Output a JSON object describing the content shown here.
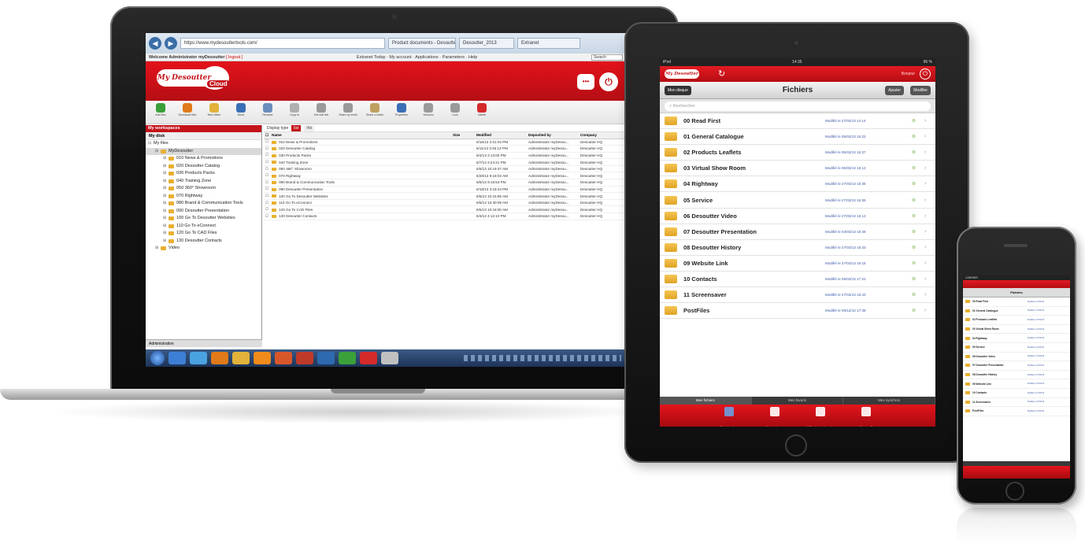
{
  "laptop": {
    "browser": {
      "address": "https://www.mydesouttertools.com/",
      "tabs": [
        "Product documents - Desoutter",
        "Desoutter_2013",
        "Extranet"
      ],
      "search_placeholder": "Search",
      "welcome": "Welcome Administrator myDesoutter",
      "logout": "[ logout ]",
      "menu_links": "Extranet Today · My account · Applications · Parameters · Help"
    },
    "app": {
      "logo_text": "My Desoutter",
      "logo_cloud": "Cloud",
      "toolbar": [
        {
          "label": "Add files",
          "icon": "add-icon",
          "color": "#3aa03a"
        },
        {
          "label": "Download files",
          "icon": "download-icon",
          "color": "#e07a1a"
        },
        {
          "label": "New folder",
          "icon": "new-folder-icon",
          "color": "#e2b23a"
        },
        {
          "label": "Move",
          "icon": "move-icon",
          "color": "#3a6fb5"
        },
        {
          "label": "Rename",
          "icon": "rename-icon",
          "color": "#6a8fbf"
        },
        {
          "label": "Copy to",
          "icon": "copy-icon",
          "color": "#b0b0b0"
        },
        {
          "label": "Get edit link",
          "icon": "edit-link-icon",
          "color": "#9a9a9a"
        },
        {
          "label": "Share by email",
          "icon": "share-email-icon",
          "color": "#9a9a9a"
        },
        {
          "label": "Share a folder",
          "icon": "share-folder-icon",
          "color": "#c0a060"
        },
        {
          "label": "Properties",
          "icon": "info-icon",
          "color": "#3a6fb5"
        },
        {
          "label": "Versions",
          "icon": "versions-icon",
          "color": "#9a9a9a"
        },
        {
          "label": "Lock",
          "icon": "lock-icon",
          "color": "#9a9a9a"
        },
        {
          "label": "Delete",
          "icon": "delete-icon",
          "color": "#d42a2a"
        }
      ],
      "hdr_btn1": "•••",
      "hdr_btn2": "⏻",
      "workspace_title": "My workspaces",
      "my_disk": "My disk",
      "my_files": "My files",
      "tree": [
        "MyDesoutter",
        "010 News & Promotions",
        "020 Desoutter Catalog",
        "030 Products Packs",
        "040 Training Zone",
        "050 360° Showroom",
        "070 Rightway",
        "080 Brand & Communication Tools",
        "090 Desoutter Presentation",
        "100 Go To Desoutter Websites",
        "110 Go To eConnect",
        "120 Go To CAD Files",
        "130 Desoutter Contacts",
        "Video"
      ],
      "administration": "Administration",
      "display_type": "Display type",
      "display_opt1": "list",
      "display_opt2": "thb",
      "columns": [
        "Name",
        "Size",
        "Modified",
        "Deposited by",
        "Company"
      ],
      "files": [
        [
          "010 News & Promotions",
          "",
          "6/18/13 2:01:04 PM",
          "Administrator myDesou...",
          "Desoutter HQ"
        ],
        [
          "020 Desoutter Catalog",
          "",
          "6/11/13 3:46:13 PM",
          "Administrator myDesou...",
          "Desoutter HQ"
        ],
        [
          "030 Products Packs",
          "",
          "6/4/13 2:13:05 PM",
          "Administrator myDesou...",
          "Desoutter HQ"
        ],
        [
          "040 Training Zone",
          "",
          "6/7/13 2:24:21 PM",
          "Administrator myDesou...",
          "Desoutter HQ"
        ],
        [
          "050 360° Showroom",
          "",
          "6/5/13 10:19:37 AM",
          "Administrator myDesou...",
          "Desoutter HQ"
        ],
        [
          "070 Rightway",
          "",
          "5/28/13 9:18:02 AM",
          "Administrator myDesou...",
          "Desoutter HQ"
        ],
        [
          "080 Brand & Communication Tools",
          "",
          "6/6/13 9:19:53 PM",
          "Administrator myDesou...",
          "Desoutter HQ"
        ],
        [
          "090 Desoutter Presentation",
          "",
          "6/18/13 3:18:24 PM",
          "Administrator myDesou...",
          "Desoutter HQ"
        ],
        [
          "100 Go To Desoutter Websites",
          "",
          "6/5/13 10:15:55 AM",
          "Administrator myDesou...",
          "Desoutter HQ"
        ],
        [
          "110 Go To eConnect",
          "",
          "6/5/13 10:30:09 AM",
          "Administrator myDesou...",
          "Desoutter HQ"
        ],
        [
          "120 Go To CAD Files",
          "",
          "6/5/13 10:16:00 AM",
          "Administrator myDesou...",
          "Desoutter HQ"
        ],
        [
          "130 Desoutter Contacts",
          "",
          "6/4/13 4:12:10 PM",
          "Administrator myDesou...",
          "Desoutter HQ"
        ]
      ],
      "taskbar_colors": [
        "#3d7fd6",
        "#4aa3e0",
        "#e07a1a",
        "#e2b23a",
        "#f08a1a",
        "#d8572a",
        "#c03a2a",
        "#2d6ab0",
        "#3aa03a",
        "#d42a2a",
        "#c0c0c0"
      ]
    }
  },
  "tablet": {
    "status_left": "iPod",
    "status_time": "14:35",
    "status_right": "96 %",
    "logo": "My Desoutter",
    "refresh": "↻",
    "user": "Bonjour",
    "power": "⏻",
    "back": "Mon disque",
    "title": "Fichiers",
    "add": "Ajouter",
    "modify": "Modifier",
    "search_placeholder": "Rechercher",
    "rows": [
      {
        "name": "00 Read First",
        "modified": "Modifié le 27/03/13 14:14"
      },
      {
        "name": "01 General Catalogue",
        "modified": "Modifié le 05/03/13 16:22"
      },
      {
        "name": "02 Products Leaflets",
        "modified": "Modifié le 05/03/13 15:37"
      },
      {
        "name": "03 Virtual Show Room",
        "modified": "Modifié le 05/03/13 15:12"
      },
      {
        "name": "04 Rightway",
        "modified": "Modifié le 27/03/13 15:36"
      },
      {
        "name": "05 Service",
        "modified": "Modifié le 27/03/13 15:36"
      },
      {
        "name": "06 Desoutter Video",
        "modified": "Modifié le 27/03/13 15:12"
      },
      {
        "name": "07 Desoutter Presentation",
        "modified": "Modifié le 04/03/13 16:48"
      },
      {
        "name": "08 Desoutter History",
        "modified": "Modifié le 27/03/13 16:33"
      },
      {
        "name": "09 Website Link",
        "modified": "Modifié le 27/03/13 16:15"
      },
      {
        "name": "10 Contacts",
        "modified": "Modifié le 05/03/13 17:22"
      },
      {
        "name": "11 Screensaver",
        "modified": "Modifié le 27/03/13 16:43"
      },
      {
        "name": "PostFiles",
        "modified": "Modifié le 05/12/12 17:38"
      }
    ],
    "segments": [
      "Mes fichiers",
      "Mes favoris",
      "Mes synchros"
    ],
    "tabs": [
      "Mes dossiers",
      "Mes partages",
      "Utilisateurs/abonnés",
      "Mon profil"
    ]
  },
  "phone": {
    "status": "CARRIER",
    "title": "Fichiers",
    "rows": [
      "00 Read First",
      "01 General Catalogue",
      "02 Products Leaflets",
      "03 Virtual Show Room",
      "04 Rightway",
      "05 Service",
      "06 Desoutter Video",
      "07 Desoutter Presentation",
      "08 Desoutter History",
      "09 Website Link",
      "10 Contacts",
      "11 Screensaver",
      "PostFiles"
    ],
    "row_modified": "Modifié le 27/03/13"
  }
}
